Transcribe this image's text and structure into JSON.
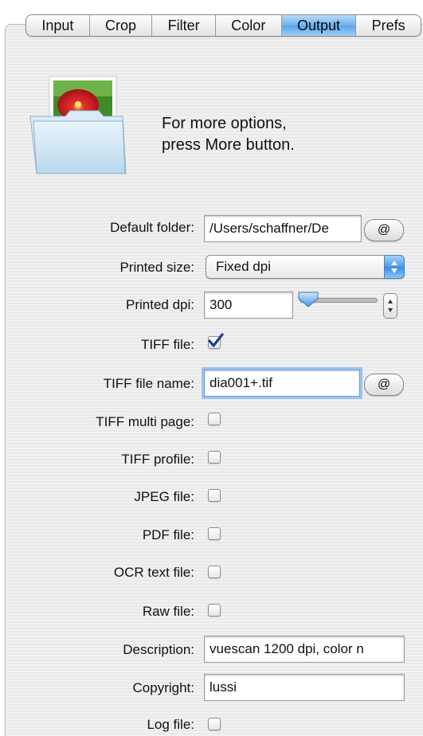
{
  "tabs": [
    {
      "label": "Input",
      "active": false
    },
    {
      "label": "Crop",
      "active": false
    },
    {
      "label": "Filter",
      "active": false
    },
    {
      "label": "Color",
      "active": false
    },
    {
      "label": "Output",
      "active": true
    },
    {
      "label": "Prefs",
      "active": false
    }
  ],
  "hint": {
    "line1": "For more options,",
    "line2": "press More button."
  },
  "colors": {
    "active_tab": "#5aa5ea",
    "focus_ring": "#9cc4ee",
    "checkmark": "#1a3f8f"
  },
  "fields": {
    "default_folder": {
      "label": "Default folder:",
      "value": "/Users/schaffner/De",
      "button": "@"
    },
    "printed_size": {
      "label": "Printed size:",
      "selected": "Fixed dpi"
    },
    "printed_dpi": {
      "label": "Printed dpi:",
      "value": "300"
    },
    "tiff_file": {
      "label": "TIFF file:",
      "checked": true
    },
    "tiff_file_name": {
      "label": "TIFF file name:",
      "value": "dia001+.tif",
      "button": "@"
    },
    "tiff_multi_page": {
      "label": "TIFF multi page:",
      "checked": false
    },
    "tiff_profile": {
      "label": "TIFF profile:",
      "checked": false
    },
    "jpeg_file": {
      "label": "JPEG file:",
      "checked": false
    },
    "pdf_file": {
      "label": "PDF file:",
      "checked": false
    },
    "ocr_text_file": {
      "label": "OCR text file:",
      "checked": false
    },
    "raw_file": {
      "label": "Raw file:",
      "checked": false
    },
    "description": {
      "label": "Description:",
      "value": "vuescan 1200 dpi, color n"
    },
    "copyright": {
      "label": "Copyright:",
      "value": "lussi"
    },
    "log_file": {
      "label": "Log file:",
      "checked": false
    }
  },
  "icons": {
    "folder": "folder-with-photo-icon",
    "popup_arrows": "up-down-arrows-icon",
    "slider": "slider-thumb-icon"
  }
}
